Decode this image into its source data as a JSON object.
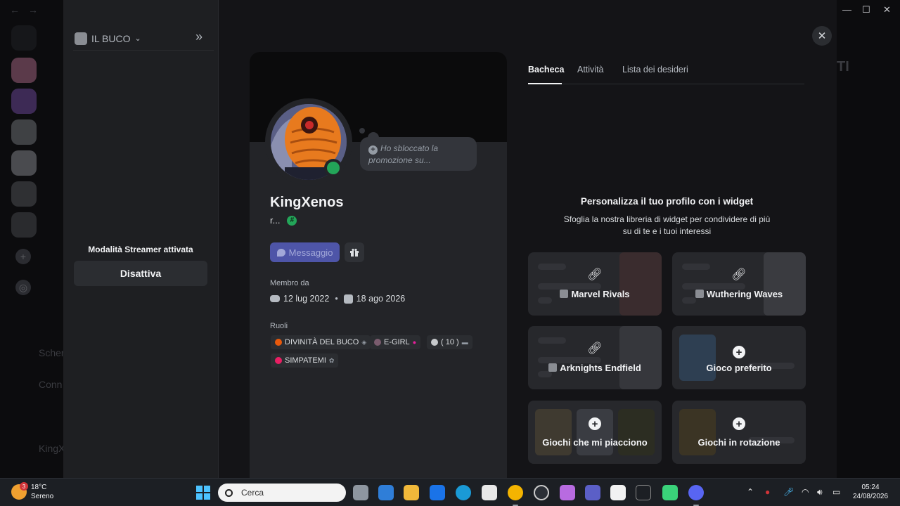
{
  "server": {
    "name": "IL BUCO"
  },
  "streamer": {
    "label": "Modalità Streamer attivata",
    "button": "Disattiva"
  },
  "profile": {
    "display_name": "KingXenos",
    "username": "r...",
    "status_bubble": "Ho sbloccato la promozione su...",
    "message_button": "Messaggio",
    "member_since_label": "Membro da",
    "discord_date": "12 lug 2022",
    "server_date": "18 ago 2026",
    "roles_label": "Ruoli",
    "roles": [
      {
        "name": "DIVINITÀ DEL BUCO",
        "color": "#e8590c"
      },
      {
        "name": "E-GIRL",
        "color": "#7a5c6e"
      },
      {
        "name": "( 10 )",
        "color": "#c7c9cc"
      },
      {
        "name": "SIMPATEMI",
        "color": "#e91e63"
      }
    ]
  },
  "tabs": [
    "Bacheca",
    "Attività",
    "Lista dei desideri"
  ],
  "widgets": {
    "title": "Personalizza il tuo profilo con i widget",
    "description": "Sfoglia la nostra libreria di widget per condividere di più su di te e i tuoi interessi",
    "tiles": [
      "Marvel Rivals",
      "Wuthering Waves",
      "Arknights Endfield",
      "Gioco preferito",
      "Giochi che mi piacciono",
      "Giochi in rotazione"
    ]
  },
  "background": {
    "fragment1": "Scher",
    "fragment2": "Conn",
    "fragment3": "KingX",
    "fragment4": "TI"
  },
  "taskbar": {
    "temperature": "18°C",
    "condition": "Sereno",
    "weather_badge": "3",
    "search_placeholder": "Cerca",
    "time": "05:24",
    "date": "24/08/2026"
  },
  "colors": {
    "accent": "#5865f2",
    "online": "#23a559"
  }
}
